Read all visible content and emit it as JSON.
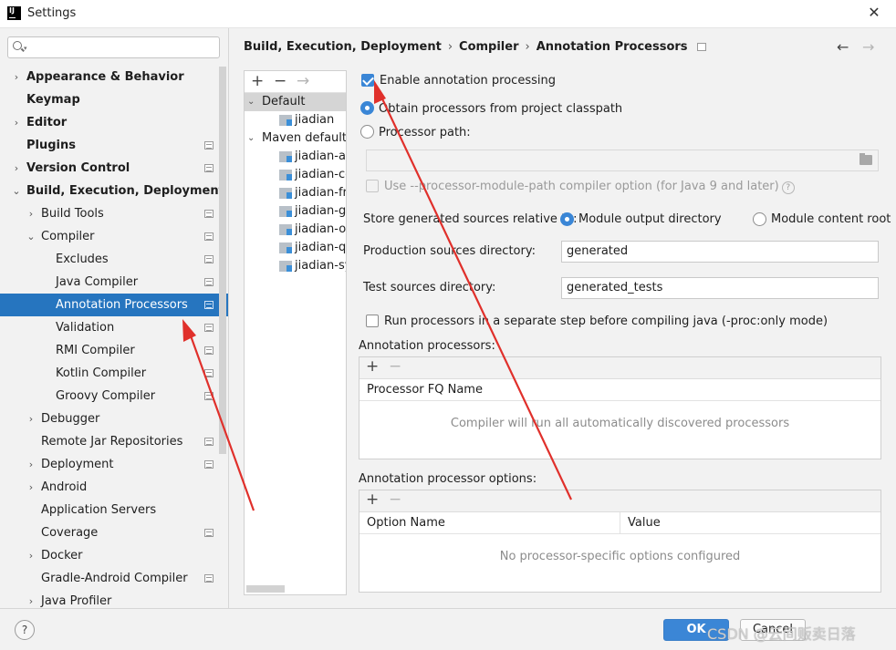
{
  "window": {
    "app_logo": "IJ",
    "title": "Settings",
    "close": "✕"
  },
  "search": {
    "placeholder": ""
  },
  "tree": [
    {
      "label": "Appearance & Behavior",
      "indent": 0,
      "arrow": "›",
      "bold": true,
      "page": false,
      "selected": false
    },
    {
      "label": "Keymap",
      "indent": 0,
      "arrow": "",
      "bold": true,
      "page": false,
      "selected": false
    },
    {
      "label": "Editor",
      "indent": 0,
      "arrow": "›",
      "bold": true,
      "page": false,
      "selected": false
    },
    {
      "label": "Plugins",
      "indent": 0,
      "arrow": "",
      "bold": true,
      "page": true,
      "selected": false
    },
    {
      "label": "Version Control",
      "indent": 0,
      "arrow": "›",
      "bold": true,
      "page": true,
      "selected": false
    },
    {
      "label": "Build, Execution, Deployment",
      "indent": 0,
      "arrow": "⌄",
      "bold": true,
      "page": false,
      "selected": false
    },
    {
      "label": "Build Tools",
      "indent": 1,
      "arrow": "›",
      "bold": false,
      "page": true,
      "selected": false
    },
    {
      "label": "Compiler",
      "indent": 1,
      "arrow": "⌄",
      "bold": false,
      "page": true,
      "selected": false
    },
    {
      "label": "Excludes",
      "indent": 2,
      "arrow": "",
      "bold": false,
      "page": true,
      "selected": false
    },
    {
      "label": "Java Compiler",
      "indent": 2,
      "arrow": "",
      "bold": false,
      "page": true,
      "selected": false
    },
    {
      "label": "Annotation Processors",
      "indent": 2,
      "arrow": "",
      "bold": false,
      "page": true,
      "selected": true
    },
    {
      "label": "Validation",
      "indent": 2,
      "arrow": "",
      "bold": false,
      "page": true,
      "selected": false
    },
    {
      "label": "RMI Compiler",
      "indent": 2,
      "arrow": "",
      "bold": false,
      "page": true,
      "selected": false
    },
    {
      "label": "Kotlin Compiler",
      "indent": 2,
      "arrow": "",
      "bold": false,
      "page": true,
      "selected": false
    },
    {
      "label": "Groovy Compiler",
      "indent": 2,
      "arrow": "",
      "bold": false,
      "page": true,
      "selected": false
    },
    {
      "label": "Debugger",
      "indent": 1,
      "arrow": "›",
      "bold": false,
      "page": false,
      "selected": false
    },
    {
      "label": "Remote Jar Repositories",
      "indent": 1,
      "arrow": "",
      "bold": false,
      "page": true,
      "selected": false
    },
    {
      "label": "Deployment",
      "indent": 1,
      "arrow": "›",
      "bold": false,
      "page": true,
      "selected": false
    },
    {
      "label": "Android",
      "indent": 1,
      "arrow": "›",
      "bold": false,
      "page": false,
      "selected": false
    },
    {
      "label": "Application Servers",
      "indent": 1,
      "arrow": "",
      "bold": false,
      "page": false,
      "selected": false
    },
    {
      "label": "Coverage",
      "indent": 1,
      "arrow": "",
      "bold": false,
      "page": true,
      "selected": false
    },
    {
      "label": "Docker",
      "indent": 1,
      "arrow": "›",
      "bold": false,
      "page": false,
      "selected": false
    },
    {
      "label": "Gradle-Android Compiler",
      "indent": 1,
      "arrow": "",
      "bold": false,
      "page": true,
      "selected": false
    },
    {
      "label": "Java Profiler",
      "indent": 1,
      "arrow": "›",
      "bold": false,
      "page": false,
      "selected": false
    }
  ],
  "breadcrumb": {
    "part1": "Build, Execution, Deployment",
    "sep1": "›",
    "part2": "Compiler",
    "sep2": "›",
    "part3": "Annotation Processors",
    "back": "←",
    "forward": "→"
  },
  "profiles": {
    "toolbar": {
      "add": "+",
      "remove": "−",
      "move": "→"
    },
    "items": [
      {
        "label": "Default",
        "level": 0,
        "arrow": "⌄",
        "module": false,
        "selected": true
      },
      {
        "label": "jiadian",
        "level": 1,
        "arrow": "",
        "module": true,
        "selected": false
      },
      {
        "label": "Maven default a",
        "level": 0,
        "arrow": "⌄",
        "module": false,
        "selected": false
      },
      {
        "label": "jiadian-ad",
        "level": 1,
        "arrow": "",
        "module": true,
        "selected": false
      },
      {
        "label": "jiadian-co",
        "level": 1,
        "arrow": "",
        "module": true,
        "selected": false
      },
      {
        "label": "jiadian-fra",
        "level": 1,
        "arrow": "",
        "module": true,
        "selected": false
      },
      {
        "label": "jiadian-ge",
        "level": 1,
        "arrow": "",
        "module": true,
        "selected": false
      },
      {
        "label": "jiadian-os",
        "level": 1,
        "arrow": "",
        "module": true,
        "selected": false
      },
      {
        "label": "jiadian-qu",
        "level": 1,
        "arrow": "",
        "module": true,
        "selected": false
      },
      {
        "label": "jiadian-sy",
        "level": 1,
        "arrow": "",
        "module": true,
        "selected": false
      }
    ]
  },
  "settings": {
    "enable_label": "Enable annotation processing",
    "enable_checked": true,
    "obtain_label": "Obtain processors from project classpath",
    "processor_path_label": "Processor path:",
    "processor_path_value": "",
    "module_path_label": "Use --processor-module-path compiler option (for Java 9 and later)",
    "help_glyph": "?",
    "store_label": "Store generated sources relative to:",
    "store_option1": "Module output directory",
    "store_option2": "Module content root",
    "prod_label": "Production sources directory:",
    "prod_value": "generated",
    "test_label": "Test sources directory:",
    "test_value": "generated_tests",
    "run_separate_label": "Run processors in a separate step before compiling java (-proc:only mode)"
  },
  "processors_panel": {
    "title": "Annotation processors:",
    "add": "+",
    "remove": "−",
    "column": "Processor FQ Name",
    "empty": "Compiler will run all automatically discovered processors"
  },
  "options_panel": {
    "title": "Annotation processor options:",
    "add": "+",
    "remove": "−",
    "col_name": "Option Name",
    "col_value": "Value",
    "empty": "No processor-specific options configured"
  },
  "footer": {
    "help": "?",
    "ok": "OK",
    "cancel": "Cancel",
    "watermark": "CSDN @云间贩卖日落"
  },
  "colors": {
    "selection": "#2675bf",
    "accent": "#3a86d6",
    "annotation_arrow": "#e0302b"
  }
}
